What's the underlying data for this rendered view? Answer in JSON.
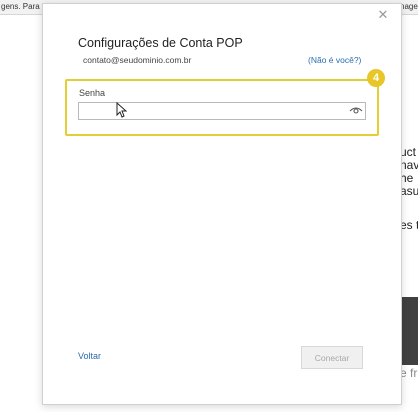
{
  "background": {
    "top_left_text": "gens. Para",
    "top_right_text": "nage",
    "side_text_lines": [
      "uct",
      "nave",
      " he",
      "asud"
    ],
    "side_text_extra": "es t",
    "bottom_fragment": "e fr"
  },
  "dialog": {
    "close_glyph": "✕",
    "title": "Configurações de Conta POP",
    "email": "contato@seudominio.com.br",
    "not_you_link": "(Não é você?)",
    "step_number": "4",
    "password_label": "Senha",
    "password_value": "",
    "back_link": "Voltar",
    "connect_button": "Conectar",
    "icons": {
      "close": "close-icon",
      "eye": "eye-icon",
      "cursor": "mouse-cursor-icon"
    },
    "colors": {
      "link": "#2b6cb0",
      "highlight": "#e3cf33",
      "badge": "#e8c627"
    }
  }
}
